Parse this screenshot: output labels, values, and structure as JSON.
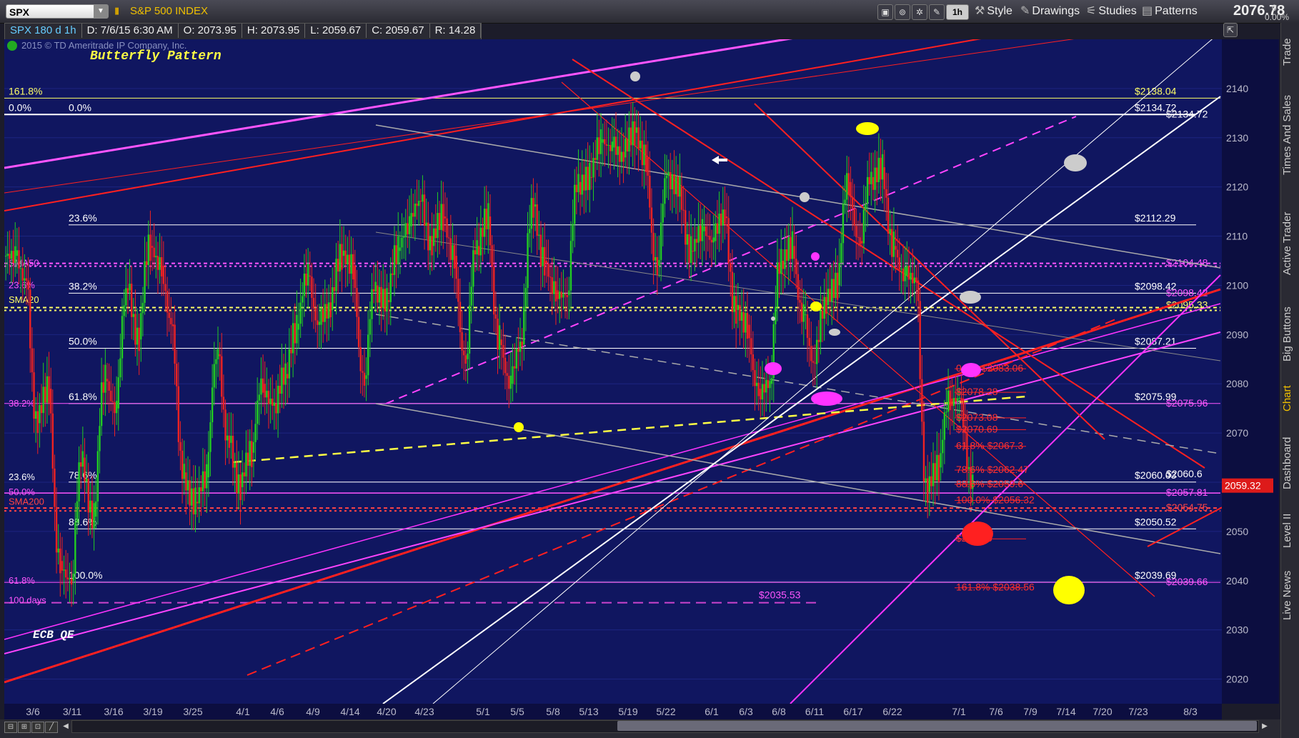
{
  "toolbar": {
    "symbol": "SPX",
    "symbol_name": "S&P 500 INDEX",
    "period_button": "1h",
    "style_label": "Style",
    "drawings_label": "Drawings",
    "studies_label": "Studies",
    "patterns_label": "Patterns",
    "last_price": "2076.78",
    "net_change": "0",
    "pct_change": "0.00%"
  },
  "infobar": {
    "symbol_period": "SPX 180 d 1h",
    "date": "D: 7/6/15 6:30 AM",
    "open": "O: 2073.95",
    "high": "H: 2073.95",
    "low": "L: 2059.67",
    "close": "C: 2059.67",
    "range": "R: 14.28"
  },
  "side_tabs": [
    "Trade",
    "Times And Sales",
    "Active Trader",
    "Big Buttons",
    "Chart",
    "Dashboard",
    "Level II",
    "Live News"
  ],
  "colors": {
    "background": "#101660",
    "up_candle": "#22cc22",
    "down_candle": "#ee2222",
    "fib_white": "#ffffff",
    "magenta": "#ff33ff",
    "red_channel": "#ff2020",
    "yellow": "#ffff00",
    "last_price_tag": "#dd1a1a"
  },
  "chart_data": {
    "type": "candlestick",
    "copyright": "2015 © TD Ameritrade IP Company, Inc.",
    "title": "Butterfly Pattern",
    "annotation_event": "ECB QE",
    "ylim": [
      2015,
      2150
    ],
    "y_ticks": [
      2020,
      2030,
      2040,
      2050,
      2060,
      2070,
      2080,
      2090,
      2100,
      2110,
      2120,
      2130,
      2140
    ],
    "x_tick_labels": [
      "3/6",
      "3/11",
      "3/16",
      "3/19",
      "3/25",
      "4/1",
      "4/6",
      "4/9",
      "4/14",
      "4/20",
      "4/23",
      "5/1",
      "5/5",
      "5/8",
      "5/13",
      "5/19",
      "5/22",
      "6/1",
      "6/3",
      "6/8",
      "6/11",
      "6/17",
      "6/22",
      "7/1",
      "7/6",
      "7/9",
      "7/14",
      "7/20",
      "7/23",
      "8/3"
    ],
    "last_price_tag": "2059.32",
    "close_series": [
      {
        "date": "3/3",
        "close": 2106
      },
      {
        "date": "3/5",
        "close": 2101
      },
      {
        "date": "3/6",
        "close": 2072
      },
      {
        "date": "3/9",
        "close": 2079
      },
      {
        "date": "3/10",
        "close": 2044
      },
      {
        "date": "3/11",
        "close": 2040
      },
      {
        "date": "3/12",
        "close": 2065
      },
      {
        "date": "3/13",
        "close": 2053
      },
      {
        "date": "3/16",
        "close": 2081
      },
      {
        "date": "3/17",
        "close": 2075
      },
      {
        "date": "3/18",
        "close": 2099
      },
      {
        "date": "3/19",
        "close": 2089
      },
      {
        "date": "3/20",
        "close": 2108
      },
      {
        "date": "3/23",
        "close": 2104
      },
      {
        "date": "3/24",
        "close": 2092
      },
      {
        "date": "3/25",
        "close": 2062
      },
      {
        "date": "3/26",
        "close": 2056
      },
      {
        "date": "3/27",
        "close": 2061
      },
      {
        "date": "3/30",
        "close": 2086
      },
      {
        "date": "3/31",
        "close": 2068
      },
      {
        "date": "4/1",
        "close": 2059
      },
      {
        "date": "4/2",
        "close": 2066
      },
      {
        "date": "4/6",
        "close": 2080
      },
      {
        "date": "4/7",
        "close": 2076
      },
      {
        "date": "4/8",
        "close": 2082
      },
      {
        "date": "4/9",
        "close": 2091
      },
      {
        "date": "4/10",
        "close": 2102
      },
      {
        "date": "4/13",
        "close": 2092
      },
      {
        "date": "4/14",
        "close": 2095
      },
      {
        "date": "4/15",
        "close": 2106
      },
      {
        "date": "4/16",
        "close": 2104
      },
      {
        "date": "4/17",
        "close": 2081
      },
      {
        "date": "4/20",
        "close": 2100
      },
      {
        "date": "4/21",
        "close": 2097
      },
      {
        "date": "4/22",
        "close": 2107
      },
      {
        "date": "4/23",
        "close": 2112
      },
      {
        "date": "4/24",
        "close": 2117
      },
      {
        "date": "4/27",
        "close": 2108
      },
      {
        "date": "4/28",
        "close": 2114
      },
      {
        "date": "4/29",
        "close": 2106
      },
      {
        "date": "4/30",
        "close": 2085
      },
      {
        "date": "5/1",
        "close": 2108
      },
      {
        "date": "5/4",
        "close": 2114
      },
      {
        "date": "5/5",
        "close": 2089
      },
      {
        "date": "5/6",
        "close": 2080
      },
      {
        "date": "5/7",
        "close": 2088
      },
      {
        "date": "5/8",
        "close": 2116
      },
      {
        "date": "5/11",
        "close": 2105
      },
      {
        "date": "5/12",
        "close": 2099
      },
      {
        "date": "5/13",
        "close": 2098
      },
      {
        "date": "5/14",
        "close": 2121
      },
      {
        "date": "5/15",
        "close": 2122
      },
      {
        "date": "5/18",
        "close": 2129
      },
      {
        "date": "5/19",
        "close": 2128
      },
      {
        "date": "5/20",
        "close": 2126
      },
      {
        "date": "5/21",
        "close": 2131
      },
      {
        "date": "5/22",
        "close": 2126
      },
      {
        "date": "5/26",
        "close": 2104
      },
      {
        "date": "5/27",
        "close": 2123
      },
      {
        "date": "5/28",
        "close": 2120
      },
      {
        "date": "5/29",
        "close": 2107
      },
      {
        "date": "6/1",
        "close": 2111
      },
      {
        "date": "6/2",
        "close": 2109
      },
      {
        "date": "6/3",
        "close": 2114
      },
      {
        "date": "6/4",
        "close": 2095
      },
      {
        "date": "6/5",
        "close": 2092
      },
      {
        "date": "6/8",
        "close": 2079
      },
      {
        "date": "6/9",
        "close": 2080
      },
      {
        "date": "6/10",
        "close": 2105
      },
      {
        "date": "6/11",
        "close": 2108
      },
      {
        "date": "6/12",
        "close": 2094
      },
      {
        "date": "6/15",
        "close": 2084
      },
      {
        "date": "6/16",
        "close": 2096
      },
      {
        "date": "6/17",
        "close": 2100
      },
      {
        "date": "6/18",
        "close": 2121
      },
      {
        "date": "6/19",
        "close": 2109
      },
      {
        "date": "6/22",
        "close": 2122
      },
      {
        "date": "6/23",
        "close": 2124
      },
      {
        "date": "6/24",
        "close": 2108
      },
      {
        "date": "6/25",
        "close": 2102
      },
      {
        "date": "6/26",
        "close": 2101
      },
      {
        "date": "6/29",
        "close": 2058
      },
      {
        "date": "6/30",
        "close": 2063
      },
      {
        "date": "7/1",
        "close": 2077
      },
      {
        "date": "7/2",
        "close": 2077
      },
      {
        "date": "7/6",
        "close": 2060
      }
    ],
    "fib_levels_left": [
      {
        "label": "161.8%",
        "price": 2138.04,
        "tag": "$2138.04",
        "color": "#ffff66"
      },
      {
        "label": "0.0%",
        "price": 2134.72,
        "tag": "$2134.72",
        "color": "#ffffff"
      },
      {
        "label": "23.6%",
        "price": 2112.29,
        "tag": "$2112.29",
        "color": "#ffffff"
      },
      {
        "label": "38.2%",
        "price": 2098.42,
        "tag": "$2098.42",
        "color": "#ffffff"
      },
      {
        "label": "50.0%",
        "price": 2087.21,
        "tag": "$2087.21",
        "color": "#ffffff"
      },
      {
        "label": "61.8%",
        "price": 2075.99,
        "tag": "$2075.99",
        "color": "#ffffff"
      },
      {
        "label": "78.6%",
        "price": 2060.03,
        "tag": "$2060.03",
        "color": "#ffffff"
      },
      {
        "label": "88.6%",
        "price": 2050.52,
        "tag": "$2050.52",
        "color": "#ffffff"
      },
      {
        "label": "100.0%",
        "price": 2039.69,
        "tag": "$2039.69",
        "color": "#ffffff"
      }
    ],
    "right_tags": [
      {
        "text": "$2104.48",
        "price": 2104.48,
        "color": "#ff55ff"
      },
      {
        "text": "$2098.42",
        "price": 2098.42,
        "color": "#ff55ff"
      },
      {
        "text": "$2095.33",
        "price": 2095.9,
        "color": "#ffff66"
      },
      {
        "text": "$2075.96",
        "price": 2075.96,
        "color": "#ff55ff"
      },
      {
        "text": "$2060.6",
        "price": 2061.6,
        "color": "#ffffff"
      },
      {
        "text": "$2057.81",
        "price": 2057.81,
        "color": "#ff55ff"
      },
      {
        "text": "$2054.75",
        "price": 2054.75,
        "color": "#ff4444"
      },
      {
        "text": "$2039.66",
        "price": 2039.66,
        "color": "#ff55ff"
      },
      {
        "text": "$2134.72",
        "price": 2134.72,
        "color": "#ffffff"
      }
    ],
    "left_labels": [
      {
        "text": "SMA50",
        "price": 2104.48,
        "color": "#ff55ff"
      },
      {
        "text": "23.6%",
        "price": 2100,
        "color": "#ff55ff"
      },
      {
        "text": "SMA20",
        "price": 2097,
        "color": "#ffff66"
      },
      {
        "text": "38.2%",
        "price": 2076,
        "color": "#ff55ff"
      },
      {
        "text": "23.6%",
        "price": 2061,
        "color": "#ffffff"
      },
      {
        "text": "50.0%",
        "price": 2058,
        "color": "#ff55ff"
      },
      {
        "text": "SMA200",
        "price": 2056,
        "color": "#ff4444"
      },
      {
        "text": "61.8%",
        "price": 2040,
        "color": "#ff55ff"
      },
      {
        "text": "100 days",
        "price": 2036,
        "color": "#ff55ff"
      }
    ],
    "sma_lines": [
      {
        "name": "SMA50",
        "price": 2104.48,
        "color": "#ff55ff"
      },
      {
        "name": "SMA20",
        "price": 2095.5,
        "color": "#ffff66"
      },
      {
        "name": "SMA200",
        "price": 2054.75,
        "color": "#ff4444"
      }
    ],
    "recent_fibs": [
      {
        "text": "0.0%  $2083.06",
        "price": 2083.06
      },
      {
        "text": "$2078.28",
        "price": 2078.28
      },
      {
        "text": "$2073.08",
        "price": 2073.08
      },
      {
        "text": "$2070.69",
        "price": 2070.69
      },
      {
        "text": "61.8%  $2067.3",
        "price": 2067.3
      },
      {
        "text": "78.6%  $2062.47",
        "price": 2062.47
      },
      {
        "text": "88.6%  $2059.6",
        "price": 2059.6
      },
      {
        "text": "100.0%  $2056.32",
        "price": 2056.32
      },
      {
        "text": "$2048.5",
        "price": 2048.5
      },
      {
        "text": "161.8%  $2038.56",
        "price": 2038.56
      }
    ],
    "other_annotations": [
      {
        "text": "$2035.53",
        "price": 2035.53
      }
    ],
    "left_fib_mid": [
      {
        "label": "0.0%",
        "price": 2134.72
      }
    ]
  }
}
